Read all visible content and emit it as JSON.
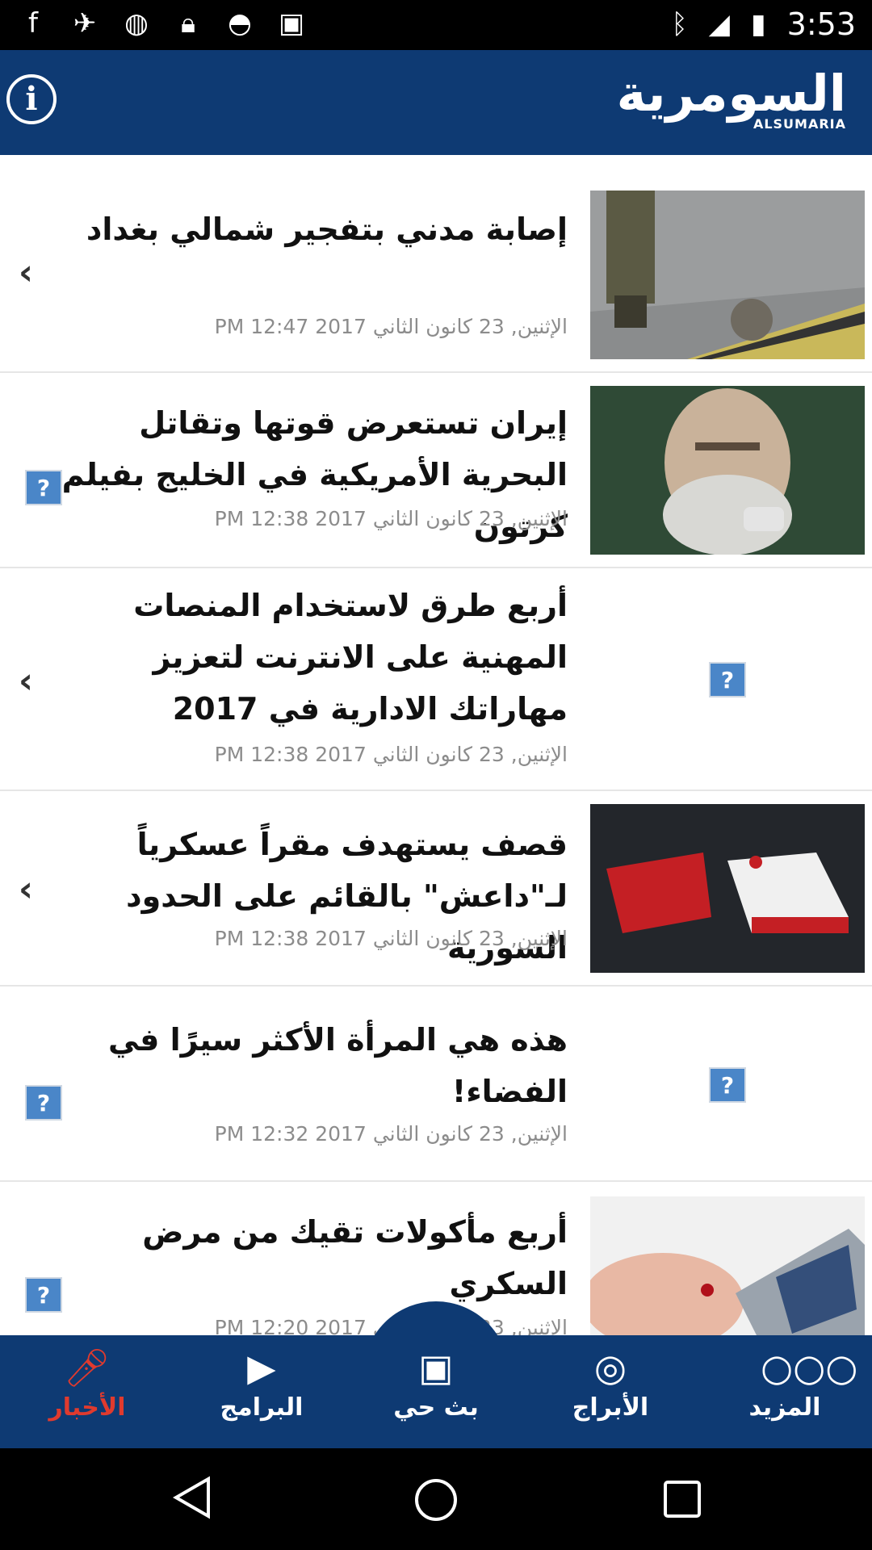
{
  "status_bar": {
    "time": "3:53",
    "left_icons": [
      "facebook-icon",
      "fake-gps-icon",
      "data-saver-icon",
      "lock-icon",
      "android-icon",
      "inbox-icon"
    ],
    "right_icons": [
      "bluetooth-icon",
      "signal-icon",
      "battery-icon"
    ]
  },
  "header": {
    "logo_ar": "السومرية",
    "logo_en": "ALSUMARIA"
  },
  "articles": [
    {
      "title": "إصابة مدني بتفجير شمالي بغداد",
      "date": "الإثنين, 23 كانون الثاني 2017 12:47 PM",
      "thumb": "photo",
      "left": "chevron"
    },
    {
      "title": "إيران تستعرض قوتها وتقاتل البحرية الأمريكية في الخليج بفيلم كرتون",
      "date": "الإثنين, 23 كانون الثاني 2017 12:38 PM",
      "thumb": "photo",
      "left": "broken-image"
    },
    {
      "title": "أربع طرق لاستخدام المنصات المهنية على الانترنت لتعزيز مهاراتك الادارية في 2017",
      "date": "الإثنين, 23 كانون الثاني 2017 12:38 PM",
      "thumb": "broken-image",
      "left": "chevron"
    },
    {
      "title": "قصف يستهدف مقراً عسكرياً لـ\"داعش\" بالقائم على الحدود السورية",
      "date": "الإثنين, 23 كانون الثاني 2017 12:38 PM",
      "thumb": "map",
      "left": "chevron"
    },
    {
      "title": "هذه هي المرأة الأكثر سيرًا في الفضاء!",
      "date": "الإثنين, 23 كانون الثاني 2017 12:32 PM",
      "thumb": "broken-image",
      "left": "broken-image"
    },
    {
      "title": "أربع مأكولات تقيك من مرض السكري",
      "date": "الإثنين, 23 كانون الثاني 2017 12:20 PM",
      "thumb": "photo",
      "left": "broken-image"
    }
  ],
  "tabs": [
    {
      "label": "الأخبار",
      "icon": "microphone-icon",
      "active": true
    },
    {
      "label": "البرامج",
      "icon": "film-icon",
      "active": false
    },
    {
      "label": "بث حي",
      "icon": "tv-icon",
      "active": false
    },
    {
      "label": "الأبراج",
      "icon": "zodiac-icon",
      "active": false
    },
    {
      "label": "المزيد",
      "icon": "more-icon",
      "active": false
    }
  ],
  "colors": {
    "brand": "#0e3a73",
    "active_tab": "#e03a2e",
    "date_text": "#8c8c8c"
  }
}
